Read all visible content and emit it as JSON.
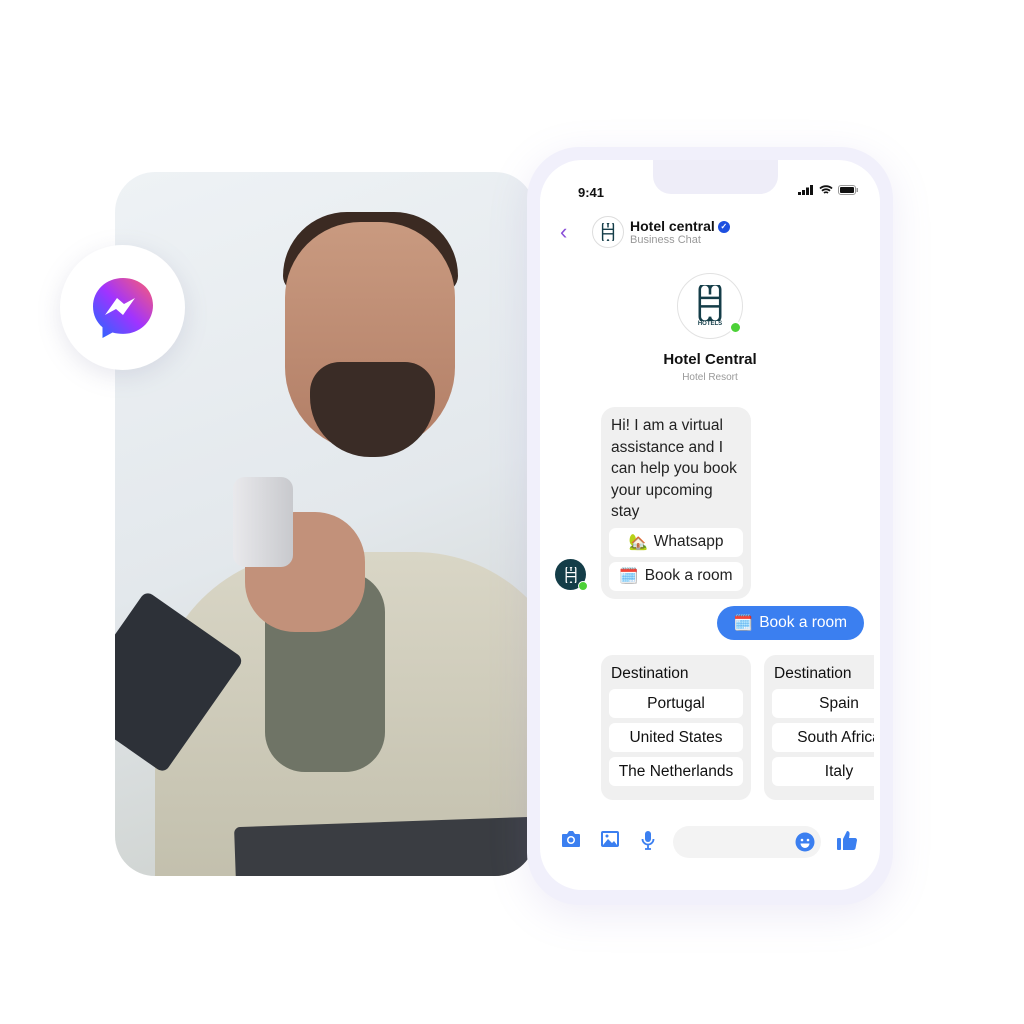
{
  "status_bar": {
    "time": "9:41"
  },
  "header": {
    "name": "Hotel central",
    "subtitle": "Business Chat",
    "verified": true
  },
  "profile": {
    "logo_text": "HOTELS",
    "name": "Hotel Central",
    "type": "Hotel Resort",
    "online": true
  },
  "messages": {
    "bot_text": "Hi! I am a virtual assistance and I can help you book your upcoming stay",
    "quick_replies": [
      {
        "icon": "house-emoji",
        "label": "Whatsapp"
      },
      {
        "icon": "calendar-emoji",
        "label": "Book a room"
      }
    ],
    "sent": {
      "icon": "calendar-emoji",
      "label": "Book a room"
    }
  },
  "cards": [
    {
      "title": "Destination",
      "options": [
        "Portugal",
        "United States",
        "The Netherlands"
      ]
    },
    {
      "title": "Destination",
      "options": [
        "Spain",
        "South Africa",
        "Italy"
      ]
    }
  ],
  "composer": {
    "icons": [
      "camera-icon",
      "image-icon",
      "microphone-icon",
      "emoji-icon",
      "thumbs-up-icon"
    ],
    "value": ""
  },
  "colors": {
    "accent": "#3b7ff0",
    "back": "#8a4fd8",
    "online": "#4cd137",
    "bubble": "#f0f0f0",
    "logo": "#143d48"
  }
}
